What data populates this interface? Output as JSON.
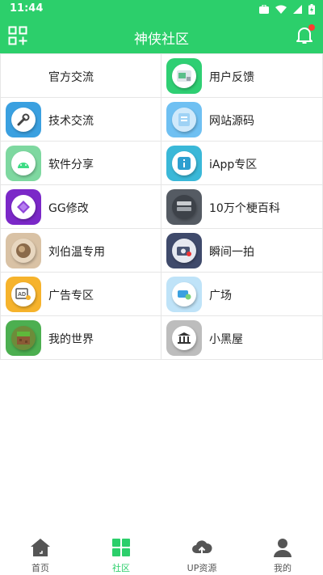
{
  "status_bar": {
    "time": "11:44"
  },
  "app_bar": {
    "title": "神侠社区"
  },
  "colors": {
    "accent": "#2ccf6b",
    "notification_dot": "#ff3b30"
  },
  "grid": {
    "rows": [
      [
        {
          "label": "官方交流",
          "icon": "none"
        },
        {
          "label": "用户反馈",
          "icon": "feedback-icon"
        }
      ],
      [
        {
          "label": "技术交流",
          "icon": "wrench-icon"
        },
        {
          "label": "网站源码",
          "icon": "website-code-icon"
        }
      ],
      [
        {
          "label": "软件分享",
          "icon": "android-icon"
        },
        {
          "label": "iApp专区",
          "icon": "iapp-icon"
        }
      ],
      [
        {
          "label": "GG修改",
          "icon": "gg-icon"
        },
        {
          "label": "10万个梗百科",
          "icon": "meme-wiki-icon"
        }
      ],
      [
        {
          "label": "刘伯温专用",
          "icon": "portrait-icon"
        },
        {
          "label": "瞬间一拍",
          "icon": "camera-icon"
        }
      ],
      [
        {
          "label": "广告专区",
          "icon": "ad-icon"
        },
        {
          "label": "广场",
          "icon": "square-icon"
        }
      ],
      [
        {
          "label": "我的世界",
          "icon": "minecraft-icon"
        },
        {
          "label": "小黑屋",
          "icon": "bank-icon"
        }
      ]
    ]
  },
  "bottom_nav": {
    "items": [
      {
        "label": "首页",
        "icon": "home-icon",
        "active": false
      },
      {
        "label": "社区",
        "icon": "community-grid-icon",
        "active": true
      },
      {
        "label": "UP资源",
        "icon": "cloud-upload-icon",
        "active": false
      },
      {
        "label": "我的",
        "icon": "profile-icon",
        "active": false
      }
    ]
  }
}
